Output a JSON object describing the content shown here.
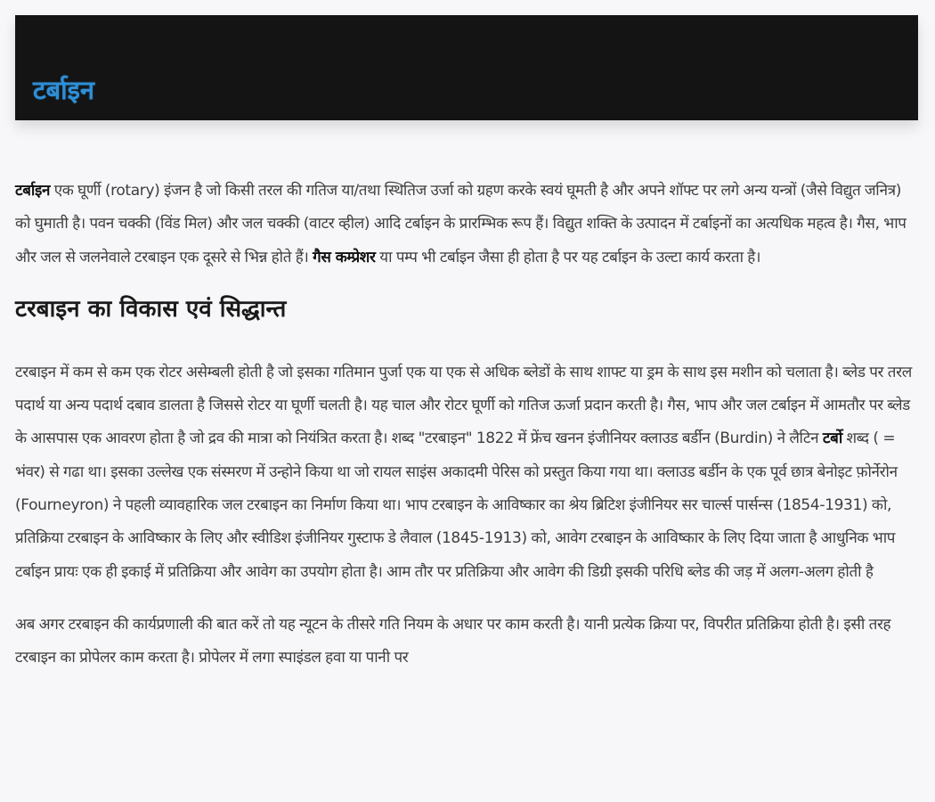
{
  "header": {
    "title": "टर्बाइन"
  },
  "intro": {
    "bold_term": "टर्बाइन",
    "text_1": " एक घूर्णी (rotary) इंजन है जो किसी तरल की गतिज या/तथा स्थितिज उर्जा को ग्रहण करके स्वयं घूमती है और अपने शॉफ्ट पर लगे अन्य यन्त्रों (जैसे विद्युत जनित्र) को घुमाती है। पवन चक्की (विंड मिल) और जल चक्की (वाटर व्हील) आदि टर्बाइन के प्रारम्भिक रूप हैं। विद्युत शक्ति के उत्पादन में टर्बाइनों का अत्यधिक महत्व है। गैस, भाप और जल से जलनेवाले टरबाइन एक दूसरे से भिन्न होते हैं। ",
    "bold_term_2": "गैस कम्प्रेशर",
    "text_2": " या पम्प भी टर्बाइन जैसा ही होता है पर यह टर्बाइन के उल्टा कार्य करता है।"
  },
  "section_vikas": {
    "heading": "टरबाइन का विकास एवं सिद्धान्त",
    "text_1": "टरबाइन में कम से कम एक रोटर असेम्बली होती है जो इसका गतिमान पुर्जा एक या एक से अधिक ब्लेडों के साथ शाफ्ट या ड्रम के साथ इस मशीन को चलाता है। ब्लेड पर तरल पदार्थ या अन्य पदार्थ दबाव डालता है जिससे रोटर या घूर्णी चलती है। यह चाल और रोटर घूर्णी को गतिज ऊर्जा प्रदान करती है। गैस, भाप और जल टर्बाइन में आमतौर पर ब्लेड के आसपास एक आवरण होता है जो द्रव की मात्रा को नियंत्रित करता है। शब्द \"टरबाइन\" 1822 में फ्रेंच खनन इंजीनियर क्लाउड बर्डीन (Burdin) ने लैटिन ",
    "bold_term": "टर्बो",
    "text_2": " शब्द ( = भंवर) से गढा था। इसका उल्लेख एक संस्मरण में उन्होने किया था जो रायल साइंस अकादमी पेरिस को प्रस्तुत किया गया था। क्लाउड बर्डीन के एक पूर्व छात्र बेनोइट फ़ोर्नेरोन (Fourneyron) ने पहली व्यावहारिक जल टरबाइन का निर्माण किया था। भाप टरबाइन के आविष्कार का श्रेय ब्रिटिश इंजीनियर सर चार्ल्स पार्सन्स (1854-1931) को, प्रतिक्रिया टरबाइन के आविष्कार के लिए और स्वीडिश इंजीनियर गुस्टाफ डे लैवाल (1845-1913) को, आवेग टरबाइन के आविष्कार के लिए दिया जाता है आधुनिक भाप टर्बाइन प्रायः एक ही इकाई में प्रतिक्रिया और आवेग का उपयोग होता है। आम तौर पर प्रतिक्रिया और आवेग की डिग्री इसकी परिधि ब्लेड की जड़ में अलग-अलग होती है",
    "text_3": "अब अगर टरबाइन की कार्यप्रणाली की बात करें तो यह न्यूटन के तीसरे गति नियम के अधार पर काम करती है। यानी प्रत्येक क्रिया पर, विपरीत प्रतिक्रिया होती है। इसी तरह टरबाइन का प्रोपेलर काम करता है। प्रोपेलर में लगा स्पाइंडल हवा या पानी पर"
  }
}
